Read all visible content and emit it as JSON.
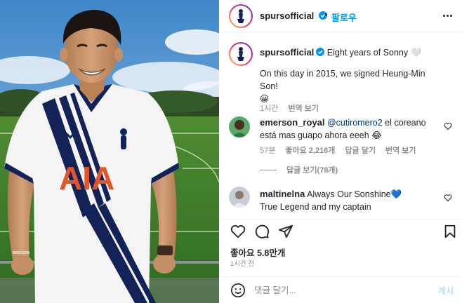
{
  "post": {
    "account": "spursofficial",
    "follow_label": "팔로우",
    "separator": "•",
    "image_text": {
      "sponsor": "AIA"
    },
    "caption": {
      "username": "spursofficial",
      "line1": "Eight years of Sonny 🤍",
      "line2": "On this day in 2015, we signed Heung-Min Son!",
      "emoji": "😀",
      "time": "1시간",
      "translate": "번역 보기"
    },
    "comments": [
      {
        "username": "emerson_royal",
        "mention": "@cutiromero2",
        "text_after_mention": " el coreano",
        "text_line2": "está mas guapo ahora eeeh 😂",
        "time": "57분",
        "likes": "좋아요 2,216개",
        "reply": "답글 달기",
        "translate": "번역 보기",
        "replies_toggle": "답글 보기(78개)"
      },
      {
        "username": "maltinelna",
        "text": "Always Our Sonshine💙",
        "text_line2": "True Legend and my captain"
      }
    ],
    "likes_count": "좋아요 5.8만개",
    "posted_time": "1시간 전",
    "comment_input": {
      "placeholder": "댓글 달기...",
      "post_label": "게시"
    },
    "icons": {
      "header": [
        "spurs-crest-icon",
        "verified-badge-icon",
        "more-options-icon"
      ],
      "actions": [
        "heart-icon",
        "comment-icon",
        "share-icon",
        "bookmark-icon"
      ],
      "compose": [
        "emoji-icon"
      ]
    },
    "colors": {
      "link_blue": "#0095f6",
      "mention": "#00376b",
      "navy": "#132257",
      "sponsor_orange": "#e2542a"
    }
  }
}
